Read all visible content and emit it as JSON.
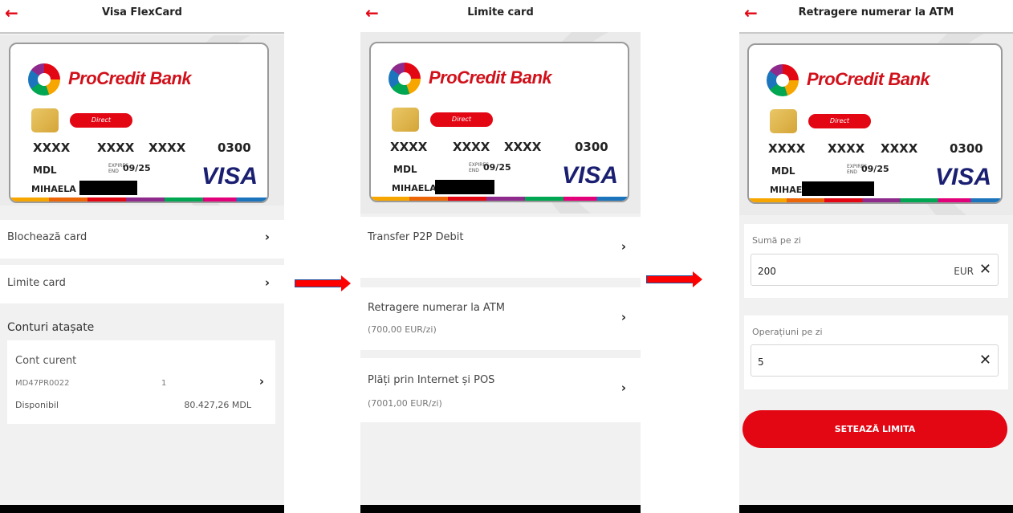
{
  "card": {
    "bank_name": "ProCredit Bank",
    "badge": "Direct",
    "numbers": [
      "XXXX",
      "XXXX",
      "XXXX",
      "0300"
    ],
    "currency": "MDL",
    "expires_label": "EXPIRES END",
    "expiry": "09/25",
    "holder": "MIHAELA",
    "network": "VISA"
  },
  "screen1": {
    "title": "Visa FlexCard",
    "back_icon": "←",
    "items": [
      {
        "label": "Blochează card"
      },
      {
        "label": "Limite card"
      }
    ],
    "section_title": "Conturi atașate",
    "account": {
      "type": "Cont curent",
      "iban": "MD47PR0022",
      "index": "1",
      "available_label": "Disponibil",
      "available_value": "80.427,26 MDL"
    }
  },
  "screen2": {
    "title": "Limite card",
    "back_icon": "←",
    "items": [
      {
        "label": "Transfer P2P Debit",
        "sub": ""
      },
      {
        "label": "Retragere numerar la ATM",
        "sub": "(700,00 EUR/zi)"
      },
      {
        "label": "Plăți prin Internet și POS",
        "sub": "(7001,00 EUR/zi)"
      }
    ]
  },
  "screen3": {
    "title": "Retragere numerar la ATM",
    "back_icon": "←",
    "fields": [
      {
        "label": "Sumă pe zi",
        "value": "200",
        "currency": "EUR"
      },
      {
        "label": "Operațiuni pe zi",
        "value": "5",
        "currency": ""
      }
    ],
    "button": "SETEAZĂ LIMITA"
  },
  "chevron": "›",
  "clear_icon": "✕",
  "colors": {
    "accent": "#e30613",
    "visa": "#1a1f71"
  }
}
